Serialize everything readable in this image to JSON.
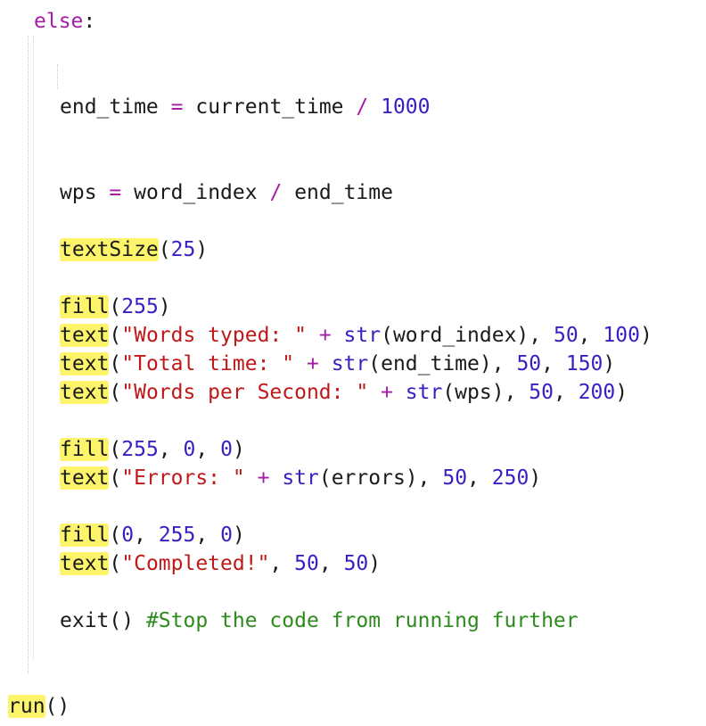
{
  "code": {
    "else_kw": "else",
    "else_colon": ":",
    "l_endtime": {
      "var": "end_time",
      "op_eq": "=",
      "rhs": "current_time",
      "op_div": "/",
      "num": "1000"
    },
    "l_wps": {
      "var": "wps",
      "op_eq": "=",
      "a": "word_index",
      "op_div": "/",
      "b": "end_time"
    },
    "l_textsize": {
      "fn": "textSize",
      "open": "(",
      "arg": "25",
      "close": ")"
    },
    "l_fill1": {
      "fn": "fill",
      "open": "(",
      "arg": "255",
      "close": ")"
    },
    "l_text1": {
      "fn": "text",
      "open": "(",
      "str": "\"Words typed: \"",
      "plus": "+",
      "builtin": "str",
      "inner": "(word_index),",
      "n1": "50",
      "comma": ",",
      "n2": "100",
      "close": ")"
    },
    "l_text2": {
      "fn": "text",
      "open": "(",
      "str": "\"Total time: \"",
      "plus": "+",
      "builtin": "str",
      "inner": "(end_time),",
      "n1": "50",
      "comma": ",",
      "n2": "150",
      "close": ")"
    },
    "l_text3": {
      "fn": "text",
      "open": "(",
      "str": "\"Words per Second: \"",
      "plus": "+",
      "builtin": "str",
      "inner": "(wps),",
      "n1": "50",
      "comma": ",",
      "n2": "200",
      "close": ")"
    },
    "l_fill2": {
      "fn": "fill",
      "open": "(",
      "n1": "255",
      "c1": ",",
      "n2": "0",
      "c2": ",",
      "n3": "0",
      "close": ")"
    },
    "l_text4": {
      "fn": "text",
      "open": "(",
      "str": "\"Errors: \"",
      "plus": "+",
      "builtin": "str",
      "inner": "(errors),",
      "n1": "50",
      "comma": ",",
      "n2": "250",
      "close": ")"
    },
    "l_fill3": {
      "fn": "fill",
      "open": "(",
      "n1": "0",
      "c1": ",",
      "n2": "255",
      "c2": ",",
      "n3": "0",
      "close": ")"
    },
    "l_text5": {
      "fn": "text",
      "open": "(",
      "str": "\"Completed!\"",
      "c1": ",",
      "n1": "50",
      "c2": ",",
      "n2": "50",
      "close": ")"
    },
    "l_exit": {
      "fn": "exit()",
      "comment": "#Stop the code from running further"
    },
    "l_run": {
      "fn": "run",
      "parens": "()"
    }
  },
  "colors": {
    "keyword": "#a61ca6",
    "number": "#3b1ec2",
    "string": "#c01818",
    "comment": "#2d8a1c",
    "highlight": "#fcf46a"
  }
}
